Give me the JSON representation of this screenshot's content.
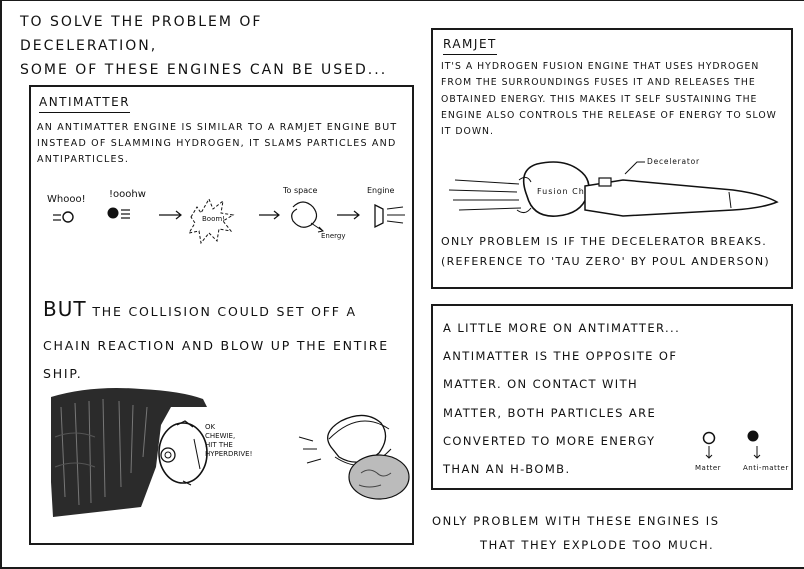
{
  "intro": {
    "line1": "To solve the problem of deceleration,",
    "line2": "some of these engines can be used..."
  },
  "antimatter": {
    "title": "Antimatter",
    "body": "An antimatter engine is similar to a ramjet engine but instead of slamming hydrogen, it slams particles and antiparticles.",
    "sequence_labels": {
      "whooo": "Whooo!",
      "ooohw": "!ooohw",
      "boom": "Boom!",
      "to_space": "To space",
      "energy": "Energy",
      "engine": "Engine"
    },
    "but_word": "But",
    "warning": "the collision could set off a chain reaction and blow up the entire ship.",
    "speech_bubble": "OK Chewie, hit the hyperdrive!"
  },
  "ramjet": {
    "title": "Ramjet",
    "body": "It's a hydrogen fusion engine that uses hydrogen from the surroundings fuses it and releases the obtained energy. This makes it self sustaining the engine also controls the release of energy to slow it down.",
    "labels": {
      "fusion_chamber": "Fusion Chamber",
      "decelerator": "Decelerator"
    },
    "problem": "Only problem is if the decelerator breaks. (Reference to 'Tau Zero' by Poul Anderson)"
  },
  "more": {
    "heading": "A little more on antimatter...",
    "body": "Antimatter is the opposite of matter. On contact with matter, both particles are converted to more energy than an H-bomb.",
    "matter_label": "Matter",
    "antimatter_label": "Anti-matter"
  },
  "conclusion": {
    "line1": "Only problem with these engines is",
    "line2": "that they explode too much."
  }
}
